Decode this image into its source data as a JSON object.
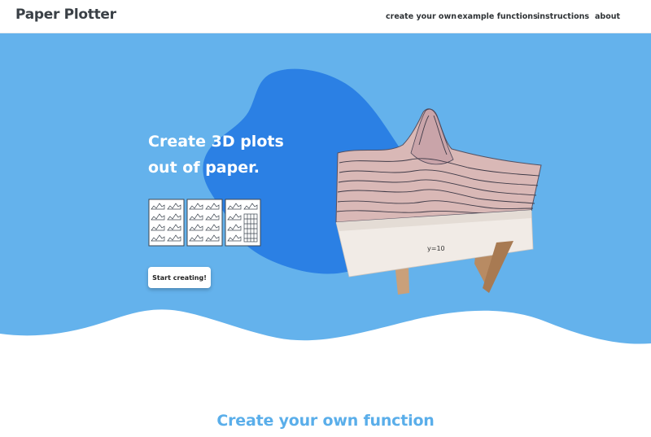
{
  "brand": "Paper Plotter",
  "nav": {
    "create": "create your own",
    "examples": "example functions",
    "instructions": "instructions",
    "about": "about"
  },
  "hero": {
    "title_line1": "Create 3D plots",
    "title_line2": "out of paper.",
    "button": "Start creating!",
    "plot_label": "y=10"
  },
  "section": {
    "title": "Create your own function"
  },
  "icons": {
    "scissors": "scissors-icon",
    "sheets": "paper-sheets-icon"
  },
  "colors": {
    "hero_bg": "#64b2ec",
    "blob": "#2b80e4",
    "accent_text": "#5aaeea",
    "nav_text": "#2f3336"
  }
}
